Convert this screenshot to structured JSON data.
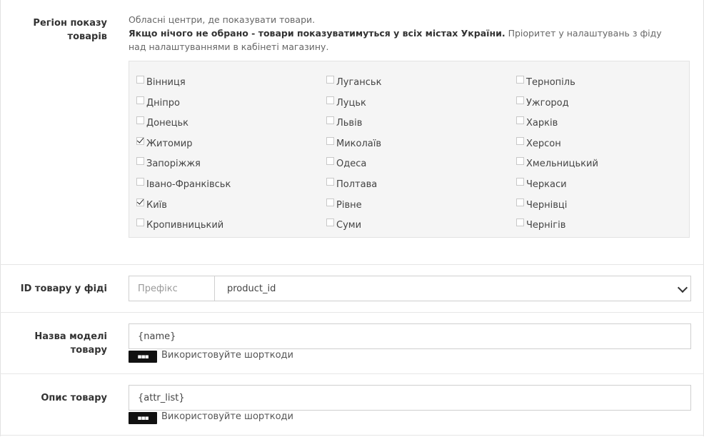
{
  "region": {
    "label": "Регіон показу товарів",
    "desc_line1": "Обласні центри, де показувати товари.",
    "desc_bold": "Якщо нічого не обрано - товари показуватимуться у всіх містах України.",
    "desc_rest": " Пріоритет у налаштувань з фіду над налаштуваннями в кабінеті магазину.",
    "columns": [
      [
        {
          "name": "Вінниця",
          "checked": false
        },
        {
          "name": "Дніпро",
          "checked": false
        },
        {
          "name": "Донецьк",
          "checked": false
        },
        {
          "name": "Житомир",
          "checked": true
        },
        {
          "name": "Запоріжжя",
          "checked": false
        },
        {
          "name": "Івано-Франківськ",
          "checked": false
        },
        {
          "name": "Київ",
          "checked": true
        },
        {
          "name": "Кропивницький",
          "checked": false
        }
      ],
      [
        {
          "name": "Луганськ",
          "checked": false
        },
        {
          "name": "Луцьк",
          "checked": false
        },
        {
          "name": "Львів",
          "checked": false
        },
        {
          "name": "Миколаїв",
          "checked": false
        },
        {
          "name": "Одеса",
          "checked": false
        },
        {
          "name": "Полтава",
          "checked": false
        },
        {
          "name": "Рівне",
          "checked": false
        },
        {
          "name": "Суми",
          "checked": false
        }
      ],
      [
        {
          "name": "Тернопіль",
          "checked": false
        },
        {
          "name": "Ужгород",
          "checked": false
        },
        {
          "name": "Харків",
          "checked": false
        },
        {
          "name": "Херсон",
          "checked": false
        },
        {
          "name": "Хмельницький",
          "checked": false
        },
        {
          "name": "Черкаси",
          "checked": false
        },
        {
          "name": "Чернівці",
          "checked": false
        },
        {
          "name": "Чернігів",
          "checked": false
        }
      ]
    ]
  },
  "product_id": {
    "label": "ID товару у фіді",
    "prefix_placeholder": "Префікс",
    "select_value": "product_id"
  },
  "model_name": {
    "label": "Назва моделі товару",
    "value": "{name}",
    "shortcodes_btn": "▪▪▪",
    "hint": "Використовуйте шорткоди"
  },
  "description": {
    "label": "Опис товару",
    "value": "{attr_list}",
    "shortcodes_btn": "▪▪▪",
    "hint": "Використовуйте шорткоди"
  }
}
